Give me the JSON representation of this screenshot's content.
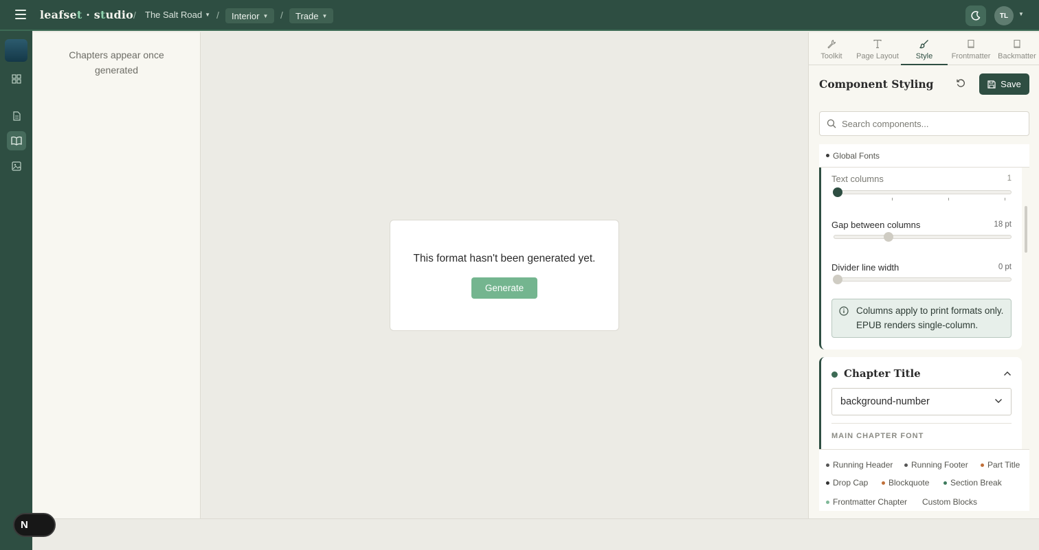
{
  "app": {
    "brand_part1": "leafse",
    "brand_accent1": "t",
    "brand_mid": " · s",
    "brand_accent2": "t",
    "brand_part2": "udio"
  },
  "breadcrumb": {
    "sep": "/",
    "project": "The Salt Road",
    "format": "Interior",
    "trim": "Trade"
  },
  "user": {
    "initials": "TL"
  },
  "chapters": {
    "empty_text": "Chapters appear once generated"
  },
  "preview": {
    "message": "This format hasn't been generated yet.",
    "generate_label": "Generate"
  },
  "floating_badge": {
    "label": "N"
  },
  "tabs": [
    {
      "label": "Toolkit",
      "icon": "wrench-icon"
    },
    {
      "label": "Page Layout",
      "icon": "text-icon"
    },
    {
      "label": "Style",
      "icon": "brush-icon"
    },
    {
      "label": "Frontmatter",
      "icon": "book-icon"
    },
    {
      "label": "Backmatter",
      "icon": "book-icon"
    }
  ],
  "panel": {
    "title": "Component Styling",
    "save_label": "Save",
    "search_placeholder": "Search components...",
    "list_head": "Global Fonts"
  },
  "columns": {
    "text_columns_label": "Text columns",
    "text_columns_value": "1",
    "text_columns_level": 0.0,
    "gap_label": "Gap between columns",
    "gap_value": "18 pt",
    "gap_level": 0.3,
    "divider_label": "Divider line width",
    "divider_value": "0 pt",
    "divider_level": 0.0,
    "info": "Columns apply to print formats only. EPUB renders single-column."
  },
  "chapter_title": {
    "title": "Chapter Title",
    "style_value": "background-number",
    "section_label": "MAIN CHAPTER FONT"
  },
  "chips": [
    {
      "label": "Running Header",
      "color": "#555555"
    },
    {
      "label": "Running Footer",
      "color": "#555555"
    },
    {
      "label": "Part Title",
      "color": "#c0703a"
    },
    {
      "label": "Drop Cap",
      "color": "#333333"
    },
    {
      "label": "Blockquote",
      "color": "#c0703a"
    },
    {
      "label": "Section Break",
      "color": "#3d7a5c"
    },
    {
      "label": "Frontmatter Chapter",
      "color": "#7fb898"
    },
    {
      "label": "Custom Blocks",
      "color": ""
    }
  ],
  "colors": {
    "brand_green": "#2e4e42",
    "accent_mint": "#8fd3ae",
    "generate_button": "#74b58f"
  }
}
